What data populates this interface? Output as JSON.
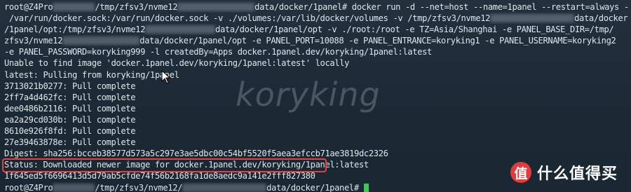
{
  "terminal": {
    "lines": [
      {
        "segments": [
          {
            "t": "root@Z4Pro"
          },
          {
            "blur": 60
          },
          {
            "t": "/tmp/zfsv3/nvme12"
          },
          {
            "blur": 110
          },
          {
            "t": "data/docker/1panel# docker run -d --net=host --name=1panel --restart=always -v"
          }
        ]
      },
      {
        "segments": [
          {
            "t": " /var/run/docker.sock:/var/run/docker.sock -v ./volumes:/var/lib/docker/volumes -v /tmp/zfsv3/nvme12"
          },
          {
            "blur": 120
          },
          {
            "t": "data/docker"
          }
        ]
      },
      {
        "segments": [
          {
            "t": "/1panel/opt:/tmp/zfsv3/nvme12"
          },
          {
            "blur": 100
          },
          {
            "t": "data/docker/1panel/opt -v ./root:/root -e TZ=Asia/Shanghai -e PANEL_BASE_DIR=/tmp/"
          }
        ]
      },
      {
        "segments": [
          {
            "t": "zfsv3/nvme12"
          },
          {
            "blur": 110
          },
          {
            "t": "data/docker/1panel/opt -e PANEL_PORT=10088 -e PANEL_ENTRANCE=koryking1 -e PANEL_USERNAME=koryking2"
          }
        ]
      },
      {
        "segments": [
          {
            "t": "-e PANEL_PASSWORD=koryking999 -l createdBy=Apps docker.1panel.dev/koryking/1panel:latest"
          }
        ]
      },
      {
        "segments": [
          {
            "t": "Unable to find image 'docker.1panel.dev/koryking/1panel:latest' locally"
          }
        ]
      },
      {
        "segments": [
          {
            "t": "latest: Pulling from koryking/1panel"
          }
        ]
      },
      {
        "segments": [
          {
            "t": "3713021b0277: Pull complete"
          }
        ]
      },
      {
        "segments": [
          {
            "t": "2ff7a4d462fc: Pull complete"
          }
        ]
      },
      {
        "segments": [
          {
            "t": "dee0486b2116: Pull complete"
          }
        ]
      },
      {
        "segments": [
          {
            "t": "ea2a29cd030b: Pull complete"
          }
        ]
      },
      {
        "segments": [
          {
            "t": "8610e926f8fd: Pull complete"
          }
        ]
      },
      {
        "segments": [
          {
            "t": "27e39463878e: Pull complete"
          }
        ]
      },
      {
        "segments": [
          {
            "t": "Digest: sha256:bcceb38577d573a5c297e3ae5dbc00c54bf5520f5aea3efccb71ae3819dc2326"
          }
        ]
      },
      {
        "segments": [
          {
            "t": "Status: Downloaded newer image for docker.1panel.dev/koryking/1panel:latest"
          }
        ]
      },
      {
        "segments": [
          {
            "t": "1f645ed5f6696413d5d79ab5cfde74f56b2168fa1de8aedc9a141e2fff827380"
          }
        ]
      },
      {
        "segments": [
          {
            "t": "root@Z4Pro"
          },
          {
            "blur": 60
          },
          {
            "t": "/tmp/zfsv3/nvme12/"
          },
          {
            "blur": 120
          },
          {
            "t": "data/docker/1panel# "
          },
          {
            "cursor": true
          }
        ]
      }
    ]
  },
  "watermark": "koryking",
  "logo": {
    "glyph": "值",
    "text": "什么值得买",
    "color": "#e33a3c"
  },
  "colors": {
    "background": "#1c2a35",
    "text": "#dfe6ea",
    "highlight": "#e8403f",
    "cursor": "#35d04a"
  }
}
